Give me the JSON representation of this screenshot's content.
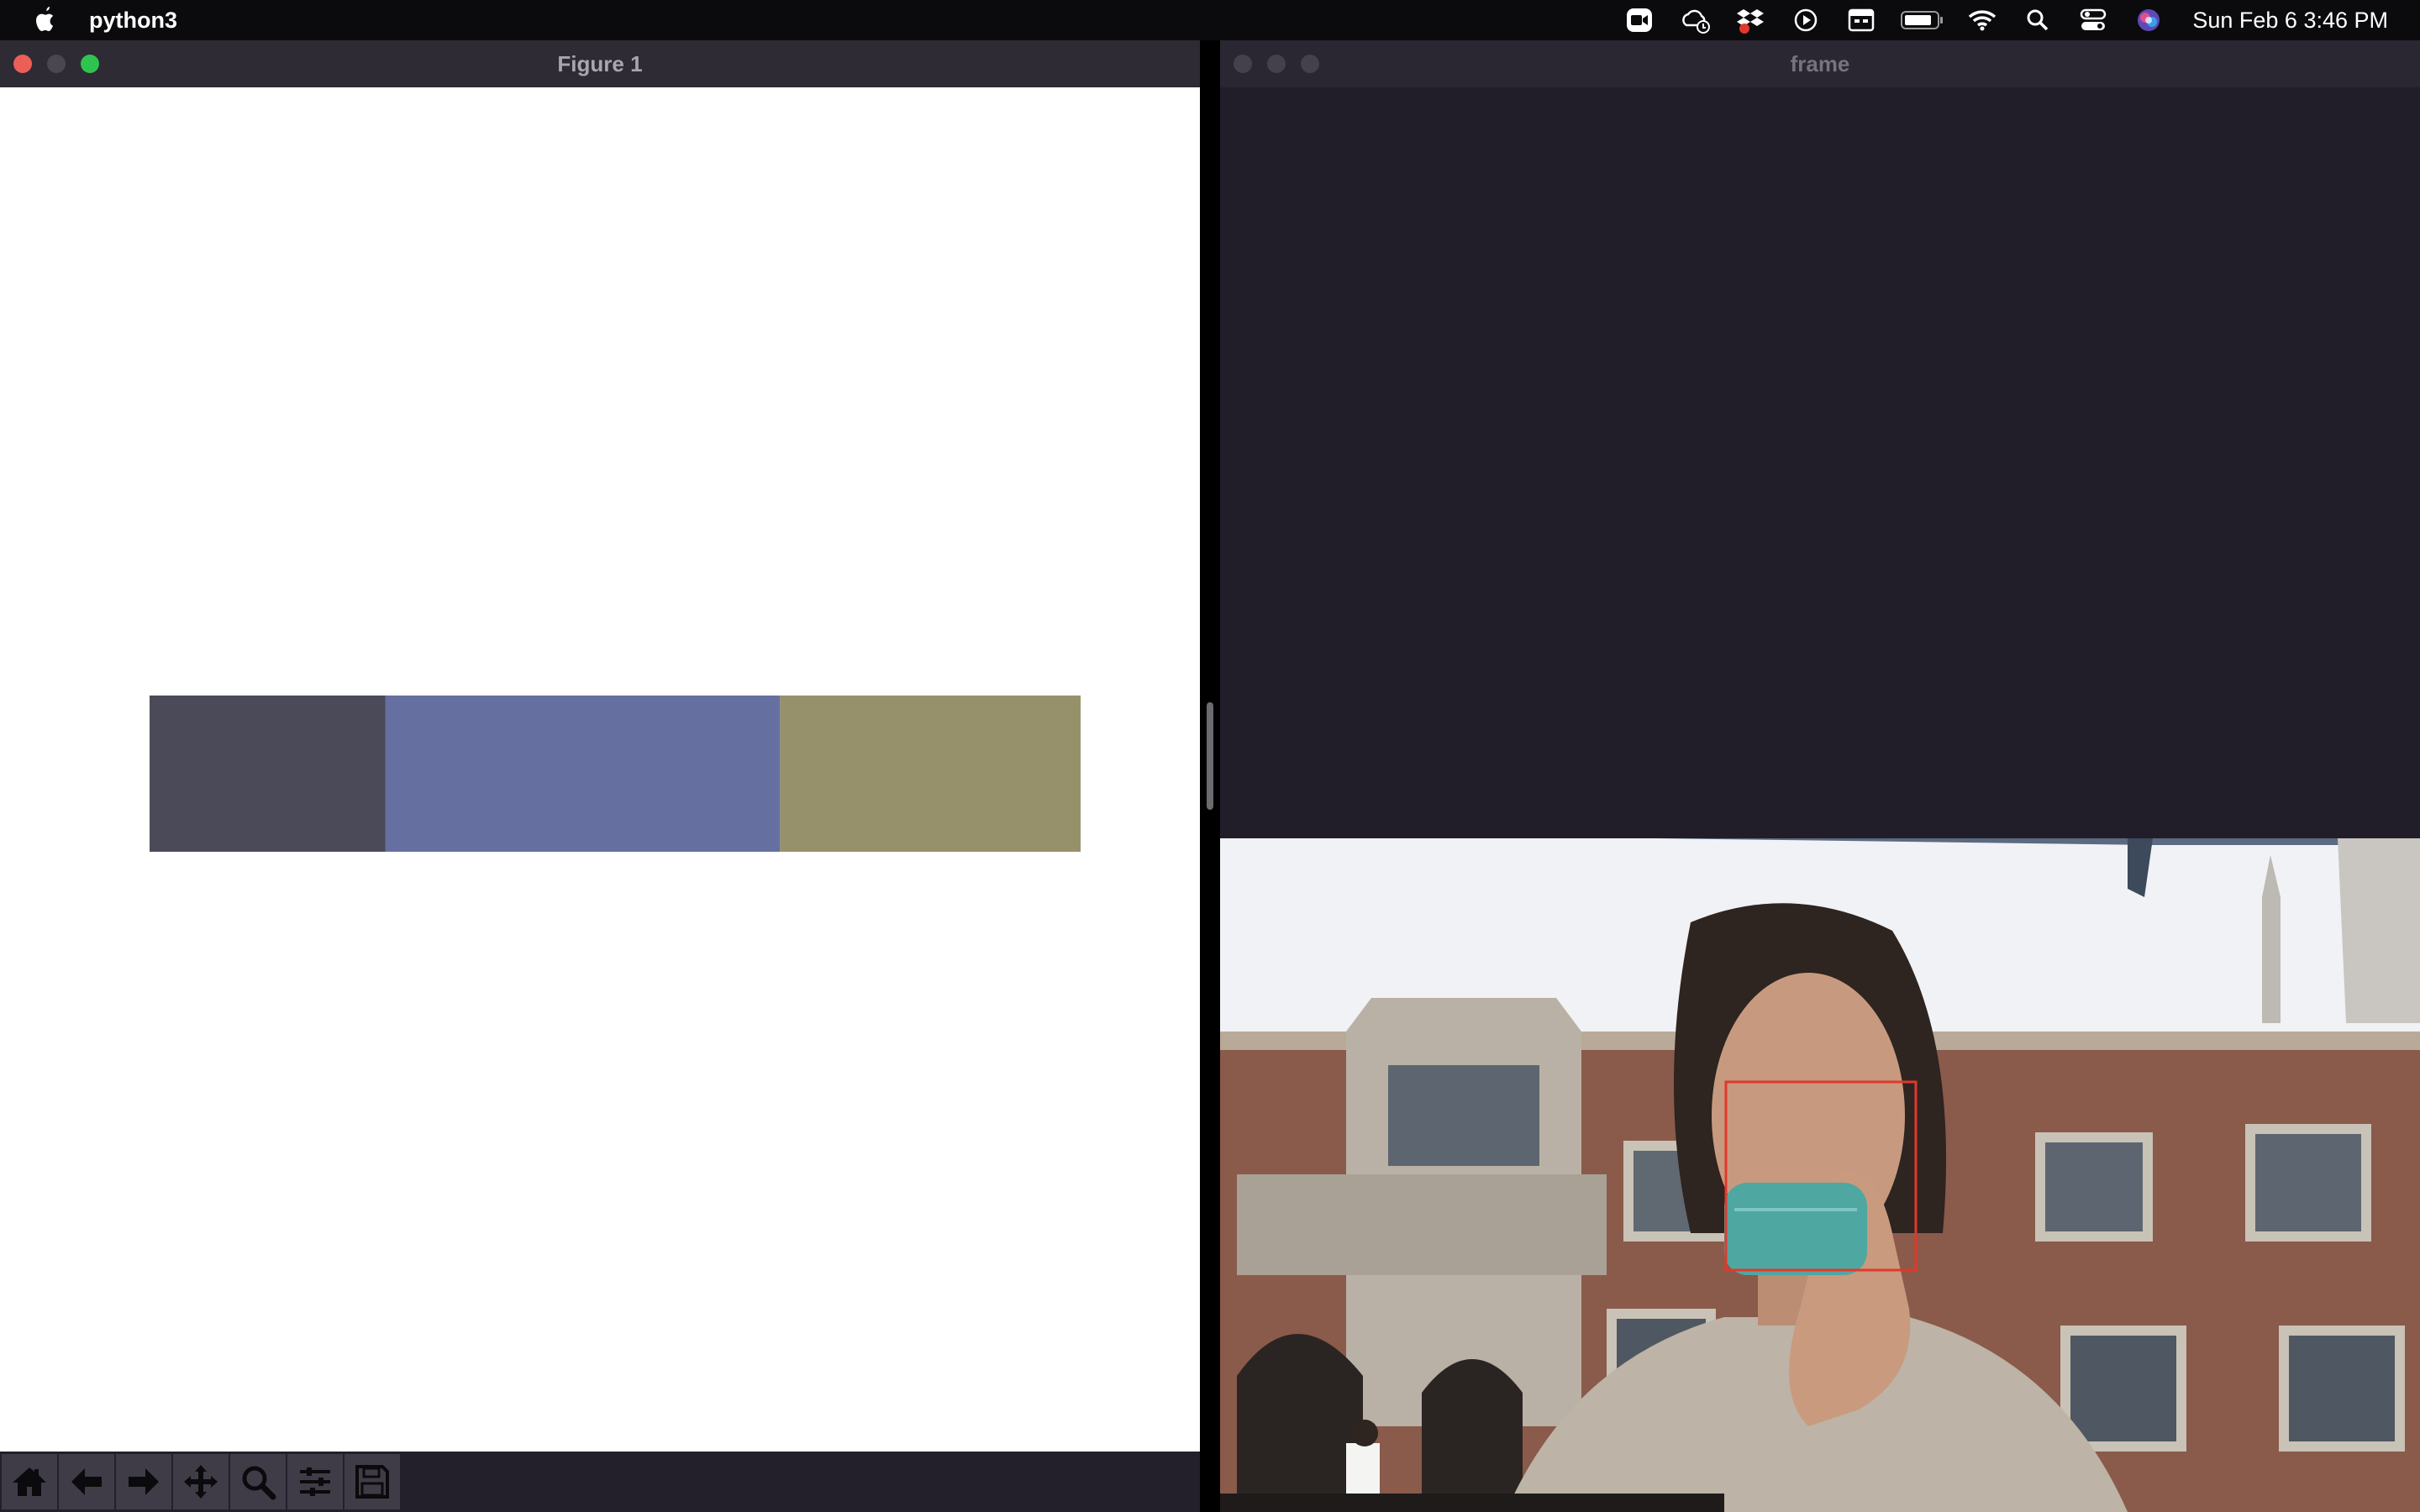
{
  "menubar": {
    "app_name": "python3",
    "clock": "Sun Feb 6  3:46 PM",
    "status_icons": [
      "zoom-icon",
      "cloud-sync-icon",
      "dropbox-icon",
      "play-icon",
      "calendar-icon",
      "battery-icon",
      "wifi-icon",
      "search-icon",
      "control-center-icon",
      "siri-icon"
    ]
  },
  "figure_window": {
    "title": "Figure 1",
    "toolbar": [
      "home-icon",
      "back-arrow-icon",
      "forward-arrow-icon",
      "pan-icon",
      "zoom-icon",
      "configure-subplots-icon",
      "save-icon"
    ]
  },
  "frame_window": {
    "title": "frame"
  },
  "chart_data": {
    "type": "bar",
    "orientation": "horizontal-stacked",
    "series": [
      {
        "color": "#4a4a58",
        "value": 0.2535
      },
      {
        "color": "#6670a0",
        "value": 0.4237
      },
      {
        "color": "#97916b",
        "value": 0.3228
      }
    ],
    "xlim": [
      0,
      1
    ],
    "grid": false,
    "axes_visible": false
  },
  "colors": {
    "menubar": "#0b0b0d",
    "figure_titlebar": "#2e2b34",
    "frame_bg": "#211e2a",
    "close": "#ec5f56",
    "zoom": "#2fc44f",
    "face_box": "#e2382b"
  }
}
